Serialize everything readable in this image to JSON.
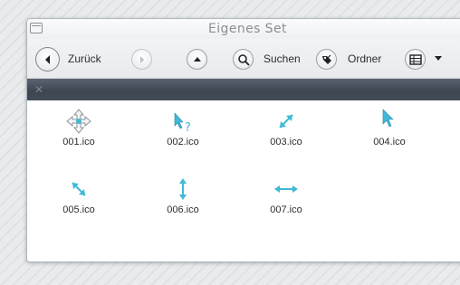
{
  "window": {
    "title": "Eigenes Set"
  },
  "toolbar": {
    "back_label": "Zurück",
    "search_label": "Suchen",
    "folder_label": "Ordner"
  },
  "files": [
    {
      "name": "001.ico",
      "icon": "move-cursor-icon"
    },
    {
      "name": "002.ico",
      "icon": "help-cursor-icon"
    },
    {
      "name": "003.ico",
      "icon": "diagonal-resize-ne-icon"
    },
    {
      "name": "004.ico",
      "icon": "arrow-cursor-icon"
    },
    {
      "name": "005.ico",
      "icon": "diagonal-resize-nw-icon"
    },
    {
      "name": "006.ico",
      "icon": "vertical-resize-icon"
    },
    {
      "name": "007.ico",
      "icon": "horizontal-resize-icon"
    }
  ],
  "colors": {
    "icon_accent": "#3fb9d6",
    "breadcrumb_bg": "#3c4651"
  }
}
